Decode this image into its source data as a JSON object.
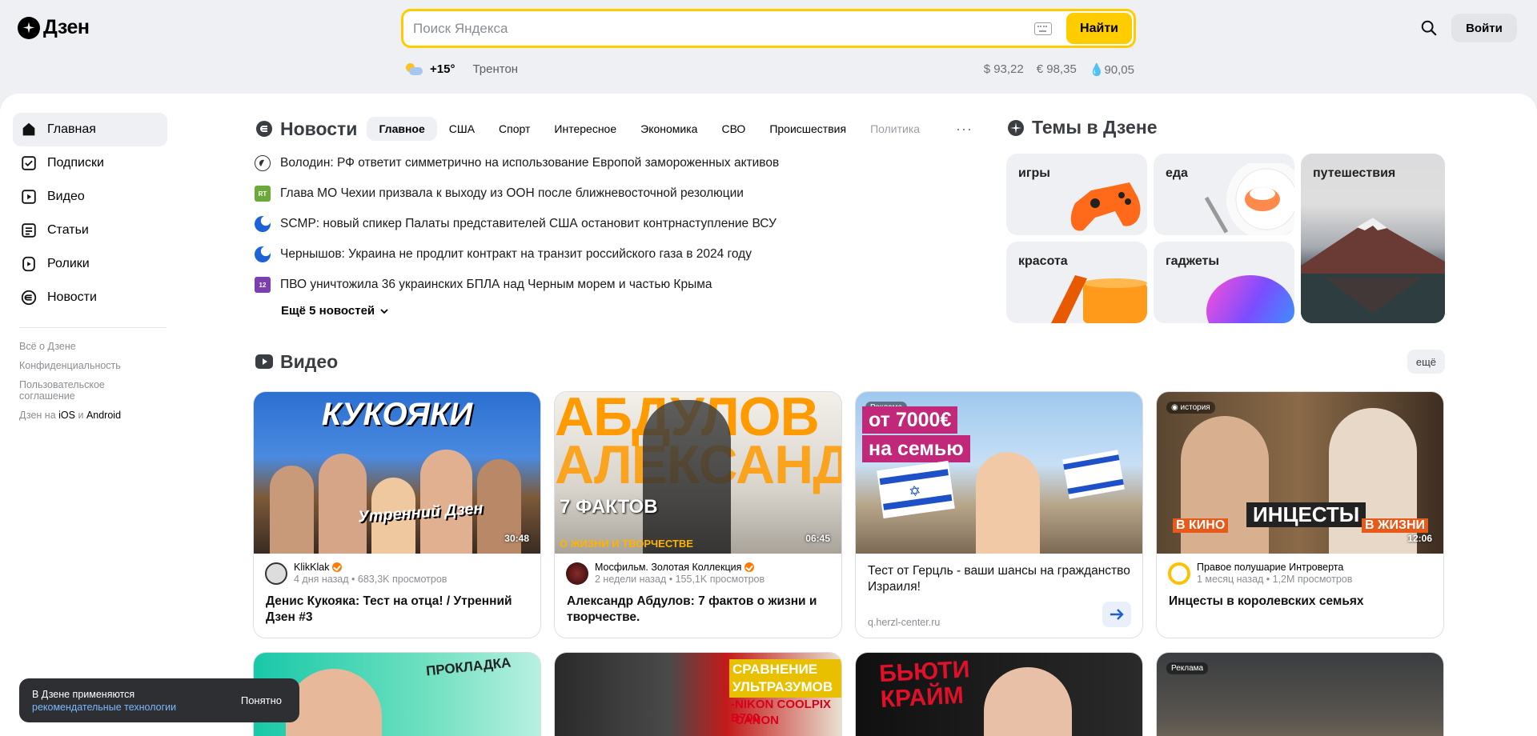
{
  "header": {
    "logo_text": "Дзен",
    "search_placeholder": "Поиск Яндекса",
    "search_button": "Найти",
    "weather_temp": "+15°",
    "weather_city": "Трентон",
    "rates": [
      "$ 93,22",
      "€ 98,35",
      "💧90,05"
    ],
    "login_button": "Войти"
  },
  "sidebar": {
    "items": [
      {
        "label": "Главная",
        "icon": "home-icon"
      },
      {
        "label": "Подписки",
        "icon": "subscriptions-icon"
      },
      {
        "label": "Видео",
        "icon": "video-icon"
      },
      {
        "label": "Статьи",
        "icon": "articles-icon"
      },
      {
        "label": "Ролики",
        "icon": "shorts-icon"
      },
      {
        "label": "Новости",
        "icon": "news-icon"
      }
    ],
    "links": {
      "about": "Всё о Дзене",
      "privacy": "Конфиденциальность",
      "terms": "Пользовательское соглашение",
      "apps_prefix": "Дзен на",
      "ios": "iOS",
      "and": "и",
      "android": "Android"
    }
  },
  "news": {
    "title": "Новости",
    "tabs": [
      "Главное",
      "США",
      "Спорт",
      "Интересное",
      "Экономика",
      "СВО",
      "Происшествия",
      "Политика"
    ],
    "items": [
      "Володин: РФ ответит симметрично на использование Европой замороженных активов",
      "Глава МО Чехии призвала к выходу из ООН после ближневосточной резолюции",
      "SCMP: новый спикер Палаты представителей США остановит контрнаступление ВСУ",
      "Чернышов: Украина не продлит контракт на транзит российского газа в 2024 году",
      "ПВО уничтожила 36 украинских БПЛА над Черным морем и частью Крыма"
    ],
    "source_badges": [
      "",
      "RT",
      "",
      "",
      "12"
    ],
    "more": "Ещё 5 новостей"
  },
  "themes": {
    "title": "Темы в Дзене",
    "items": [
      "игры",
      "еда",
      "путешествия",
      "красота",
      "гаджеты"
    ]
  },
  "videos": {
    "title": "Видео",
    "more_button": "ещё",
    "cards": [
      {
        "channel": "KlikKlak",
        "meta": "4 дня назад • 683,3K просмотров",
        "title": "Денис Кукояка: Тест на отца! / Утренний Дзен #3",
        "duration": "30:48",
        "thumb_text": "КУКОЯКИ",
        "thumb_sub": "Утренний Дзен"
      },
      {
        "channel": "Мосфильм. Золотая Коллекция",
        "meta": "2 недели назад • 155,1K просмотров",
        "title": "Александр Абдулов: 7 фактов о жизни и творчестве.",
        "duration": "06:45",
        "thumb_text": "АБДУЛОВ",
        "thumb_text2": "АЛЕКСАНДР",
        "thumb_sub": "7 ФАКТОВ",
        "thumb_sub2": "О ЖИЗНИ И ТВОРЧЕСТВЕ"
      },
      {
        "ad_label": "Реклама",
        "title": "Тест от Герцль - ваши шансы на гражданство Израиля!",
        "url": "q.herzl-center.ru",
        "thumb_text": "от 7000€",
        "thumb_text2": "на семью"
      },
      {
        "channel": "Правое полушарие Интроверта",
        "meta": "1 месяц назад • 1,2M просмотров",
        "title": "Инцесты в королевских семьях",
        "duration": "12:06",
        "badge": "история",
        "thumb_text": "ИНЦЕСТЫ",
        "thumb_left": "В КИНО",
        "thumb_right": "В ЖИЗНИ"
      }
    ],
    "row2": [
      {
        "thumb_text": "ПРОКЛАДКА"
      },
      {
        "thumb_text": "СРАВНЕНИЕ УЛЬТРАЗУМОВ",
        "thumb_text2": "-NIKON COOLPIX B700",
        "thumb_text3": "-CANON"
      },
      {
        "thumb_text": "БЬЮТИ КРАЙМ"
      },
      {
        "ad_label": "Реклама"
      }
    ]
  },
  "cookie_toast": {
    "text": "В Дзене применяются",
    "link": "рекомендательные технологии",
    "button": "Понятно"
  },
  "colors": {
    "accent": "#ffcc00",
    "background": "#eef0f3",
    "verified": "#ff7a00"
  }
}
